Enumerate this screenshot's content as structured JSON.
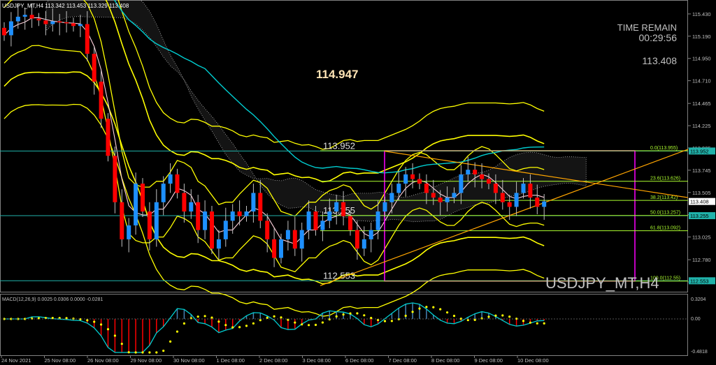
{
  "header": {
    "title": "USDJPY_MT,H4  113.342 113.453 113.329 113.408"
  },
  "overlay": {
    "time_remain_label": "TIME REMAIN",
    "time_remain_value": "00:29:56",
    "current_price": "113.408",
    "high_marker": "114.947",
    "symbol_watermark": "USDJPY_MT,H4"
  },
  "levels": [
    {
      "label": "113.952",
      "price": 113.952,
      "color": "#20b2aa"
    },
    {
      "label": "113.255",
      "price": 113.255,
      "color": "#20b2aa"
    },
    {
      "label": "112.553",
      "price": 112.553,
      "color": "#20b2aa"
    }
  ],
  "fib": [
    {
      "label": "0.0(113.955)",
      "price": 113.955
    },
    {
      "label": "23.6(113.626)",
      "price": 113.626
    },
    {
      "label": "38.2(113.42)",
      "price": 113.42
    },
    {
      "label": "50.0(113.257)",
      "price": 113.257
    },
    {
      "label": "61.8(113.092)",
      "price": 113.092
    },
    {
      "label": "100.0(112.55)",
      "price": 112.55
    }
  ],
  "price_tags": [
    {
      "label": "113.952",
      "price": 113.952,
      "bg": "#20b2aa"
    },
    {
      "label": "113.408",
      "price": 113.408,
      "bg": "#ffffff"
    },
    {
      "label": "113.255",
      "price": 113.255,
      "bg": "#20b2aa"
    },
    {
      "label": "112.553",
      "price": 112.553,
      "bg": "#20b2aa"
    }
  ],
  "macd": {
    "label": "MACD(12,26,9) 0.0025 0.0306 0.0000 -0.0281",
    "axis": [
      "0.3204",
      "0.00",
      "-0.4818"
    ]
  },
  "colors": {
    "bull": "#1e90ff",
    "bear": "#ff0000",
    "band": "#ffff00",
    "ma": "#00ced1",
    "box": "#ff00ff",
    "fib": "#adff2f"
  },
  "chart_data": {
    "type": "candlestick",
    "title": "USDJPY_MT,H4",
    "y_ticks": [
      "115.430",
      "115.190",
      "114.950",
      "114.710",
      "114.465",
      "114.225",
      "113.985",
      "113.745",
      "113.505",
      "113.265",
      "113.025",
      "112.780",
      "112.540"
    ],
    "ylim": [
      112.45,
      115.55
    ],
    "x_ticks": [
      "24 Nov 2021",
      "25 Nov 08:00",
      "26 Nov 08:00",
      "29 Nov 08:00",
      "30 Nov 08:00",
      "1 Dec 08:00",
      "2 Dec 08:00",
      "3 Dec 08:00",
      "6 Dec 08:00",
      "7 Dec 08:00",
      "8 Dec 08:00",
      "9 Dec 08:00",
      "10 Dec 08:00"
    ],
    "ohlc_close": [
      115.2,
      115.35,
      115.4,
      115.42,
      115.38,
      115.36,
      115.32,
      115.35,
      115.34,
      115.33,
      115.3,
      115.32,
      115.0,
      114.7,
      114.3,
      113.9,
      113.4,
      113.0,
      113.15,
      113.6,
      113.3,
      113.0,
      113.4,
      113.6,
      113.7,
      113.5,
      113.3,
      113.4,
      113.1,
      113.3,
      112.9,
      113.0,
      113.2,
      113.3,
      113.25,
      113.3,
      113.5,
      113.2,
      113.0,
      112.8,
      113.0,
      113.1,
      112.9,
      113.1,
      113.3,
      113.1,
      113.2,
      113.3,
      113.4,
      113.25,
      113.1,
      112.9,
      113.0,
      113.1,
      113.3,
      113.4,
      113.5,
      113.6,
      113.7,
      113.65,
      113.6,
      113.5,
      113.45,
      113.4,
      113.45,
      113.5,
      113.7,
      113.75,
      113.7,
      113.65,
      113.6,
      113.5,
      113.4,
      113.35,
      113.5,
      113.6,
      113.45,
      113.35,
      113.408
    ]
  }
}
